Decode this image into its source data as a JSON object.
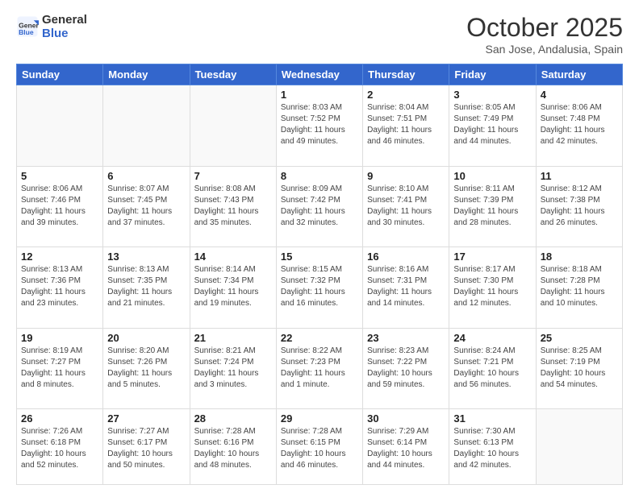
{
  "header": {
    "logo_general": "General",
    "logo_blue": "Blue",
    "month_title": "October 2025",
    "location": "San Jose, Andalusia, Spain"
  },
  "days_of_week": [
    "Sunday",
    "Monday",
    "Tuesday",
    "Wednesday",
    "Thursday",
    "Friday",
    "Saturday"
  ],
  "weeks": [
    [
      {
        "day": "",
        "info": ""
      },
      {
        "day": "",
        "info": ""
      },
      {
        "day": "",
        "info": ""
      },
      {
        "day": "1",
        "info": "Sunrise: 8:03 AM\nSunset: 7:52 PM\nDaylight: 11 hours and 49 minutes."
      },
      {
        "day": "2",
        "info": "Sunrise: 8:04 AM\nSunset: 7:51 PM\nDaylight: 11 hours and 46 minutes."
      },
      {
        "day": "3",
        "info": "Sunrise: 8:05 AM\nSunset: 7:49 PM\nDaylight: 11 hours and 44 minutes."
      },
      {
        "day": "4",
        "info": "Sunrise: 8:06 AM\nSunset: 7:48 PM\nDaylight: 11 hours and 42 minutes."
      }
    ],
    [
      {
        "day": "5",
        "info": "Sunrise: 8:06 AM\nSunset: 7:46 PM\nDaylight: 11 hours and 39 minutes."
      },
      {
        "day": "6",
        "info": "Sunrise: 8:07 AM\nSunset: 7:45 PM\nDaylight: 11 hours and 37 minutes."
      },
      {
        "day": "7",
        "info": "Sunrise: 8:08 AM\nSunset: 7:43 PM\nDaylight: 11 hours and 35 minutes."
      },
      {
        "day": "8",
        "info": "Sunrise: 8:09 AM\nSunset: 7:42 PM\nDaylight: 11 hours and 32 minutes."
      },
      {
        "day": "9",
        "info": "Sunrise: 8:10 AM\nSunset: 7:41 PM\nDaylight: 11 hours and 30 minutes."
      },
      {
        "day": "10",
        "info": "Sunrise: 8:11 AM\nSunset: 7:39 PM\nDaylight: 11 hours and 28 minutes."
      },
      {
        "day": "11",
        "info": "Sunrise: 8:12 AM\nSunset: 7:38 PM\nDaylight: 11 hours and 26 minutes."
      }
    ],
    [
      {
        "day": "12",
        "info": "Sunrise: 8:13 AM\nSunset: 7:36 PM\nDaylight: 11 hours and 23 minutes."
      },
      {
        "day": "13",
        "info": "Sunrise: 8:13 AM\nSunset: 7:35 PM\nDaylight: 11 hours and 21 minutes."
      },
      {
        "day": "14",
        "info": "Sunrise: 8:14 AM\nSunset: 7:34 PM\nDaylight: 11 hours and 19 minutes."
      },
      {
        "day": "15",
        "info": "Sunrise: 8:15 AM\nSunset: 7:32 PM\nDaylight: 11 hours and 16 minutes."
      },
      {
        "day": "16",
        "info": "Sunrise: 8:16 AM\nSunset: 7:31 PM\nDaylight: 11 hours and 14 minutes."
      },
      {
        "day": "17",
        "info": "Sunrise: 8:17 AM\nSunset: 7:30 PM\nDaylight: 11 hours and 12 minutes."
      },
      {
        "day": "18",
        "info": "Sunrise: 8:18 AM\nSunset: 7:28 PM\nDaylight: 11 hours and 10 minutes."
      }
    ],
    [
      {
        "day": "19",
        "info": "Sunrise: 8:19 AM\nSunset: 7:27 PM\nDaylight: 11 hours and 8 minutes."
      },
      {
        "day": "20",
        "info": "Sunrise: 8:20 AM\nSunset: 7:26 PM\nDaylight: 11 hours and 5 minutes."
      },
      {
        "day": "21",
        "info": "Sunrise: 8:21 AM\nSunset: 7:24 PM\nDaylight: 11 hours and 3 minutes."
      },
      {
        "day": "22",
        "info": "Sunrise: 8:22 AM\nSunset: 7:23 PM\nDaylight: 11 hours and 1 minute."
      },
      {
        "day": "23",
        "info": "Sunrise: 8:23 AM\nSunset: 7:22 PM\nDaylight: 10 hours and 59 minutes."
      },
      {
        "day": "24",
        "info": "Sunrise: 8:24 AM\nSunset: 7:21 PM\nDaylight: 10 hours and 56 minutes."
      },
      {
        "day": "25",
        "info": "Sunrise: 8:25 AM\nSunset: 7:19 PM\nDaylight: 10 hours and 54 minutes."
      }
    ],
    [
      {
        "day": "26",
        "info": "Sunrise: 7:26 AM\nSunset: 6:18 PM\nDaylight: 10 hours and 52 minutes."
      },
      {
        "day": "27",
        "info": "Sunrise: 7:27 AM\nSunset: 6:17 PM\nDaylight: 10 hours and 50 minutes."
      },
      {
        "day": "28",
        "info": "Sunrise: 7:28 AM\nSunset: 6:16 PM\nDaylight: 10 hours and 48 minutes."
      },
      {
        "day": "29",
        "info": "Sunrise: 7:28 AM\nSunset: 6:15 PM\nDaylight: 10 hours and 46 minutes."
      },
      {
        "day": "30",
        "info": "Sunrise: 7:29 AM\nSunset: 6:14 PM\nDaylight: 10 hours and 44 minutes."
      },
      {
        "day": "31",
        "info": "Sunrise: 7:30 AM\nSunset: 6:13 PM\nDaylight: 10 hours and 42 minutes."
      },
      {
        "day": "",
        "info": ""
      }
    ]
  ]
}
